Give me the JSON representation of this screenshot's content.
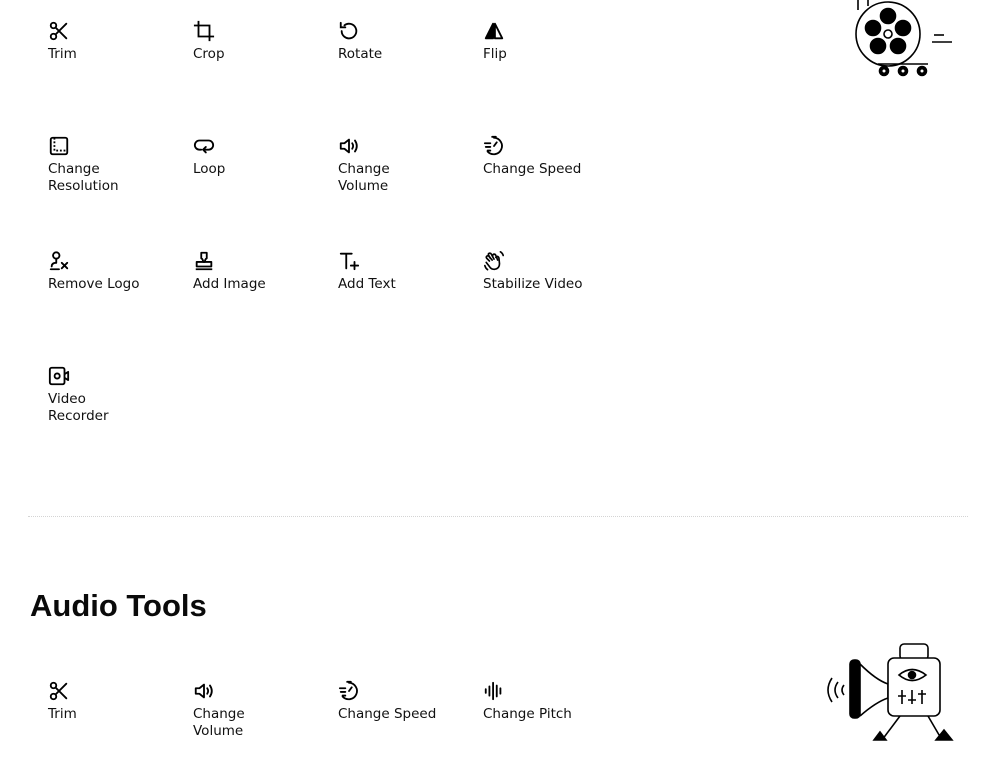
{
  "video_tools": [
    {
      "id": "trim",
      "label": "Trim",
      "icon": "scissors-icon",
      "col": 0,
      "row": 0
    },
    {
      "id": "crop",
      "label": "Crop",
      "icon": "crop-icon",
      "col": 1,
      "row": 0
    },
    {
      "id": "rotate",
      "label": "Rotate",
      "icon": "rotate-icon",
      "col": 2,
      "row": 0
    },
    {
      "id": "flip",
      "label": "Flip",
      "icon": "flip-icon",
      "col": 3,
      "row": 0
    },
    {
      "id": "change-resolution",
      "label": "Change\nResolution",
      "icon": "resolution-icon",
      "col": 0,
      "row": 1
    },
    {
      "id": "loop",
      "label": "Loop",
      "icon": "loop-icon",
      "col": 1,
      "row": 1
    },
    {
      "id": "change-volume",
      "label": "Change\nVolume",
      "icon": "volume-icon",
      "col": 2,
      "row": 1
    },
    {
      "id": "change-speed",
      "label": "Change Speed",
      "icon": "speed-icon",
      "col": 3,
      "row": 1
    },
    {
      "id": "remove-logo",
      "label": "Remove Logo",
      "icon": "remove-logo-icon",
      "col": 0,
      "row": 2
    },
    {
      "id": "add-image",
      "label": "Add Image",
      "icon": "stamp-icon",
      "col": 1,
      "row": 2
    },
    {
      "id": "add-text",
      "label": "Add Text",
      "icon": "text-add-icon",
      "col": 2,
      "row": 2
    },
    {
      "id": "stabilize-video",
      "label": "Stabilize Video",
      "icon": "hand-wave-icon",
      "col": 3,
      "row": 2
    },
    {
      "id": "video-recorder",
      "label": "Video\nRecorder",
      "icon": "camera-record-icon",
      "col": 0,
      "row": 3
    }
  ],
  "audio_section": {
    "title": "Audio Tools",
    "tools": [
      {
        "id": "audio-trim",
        "label": "Trim",
        "icon": "scissors-icon",
        "col": 0
      },
      {
        "id": "audio-change-volume",
        "label": "Change\nVolume",
        "icon": "volume-icon",
        "col": 1
      },
      {
        "id": "audio-change-speed",
        "label": "Change Speed",
        "icon": "speed-icon",
        "col": 2
      },
      {
        "id": "audio-change-pitch",
        "label": "Change Pitch",
        "icon": "waveform-icon",
        "col": 3
      }
    ]
  },
  "colors": {
    "text": "#111111",
    "background": "#ffffff",
    "divider": "#d4d4d4"
  }
}
